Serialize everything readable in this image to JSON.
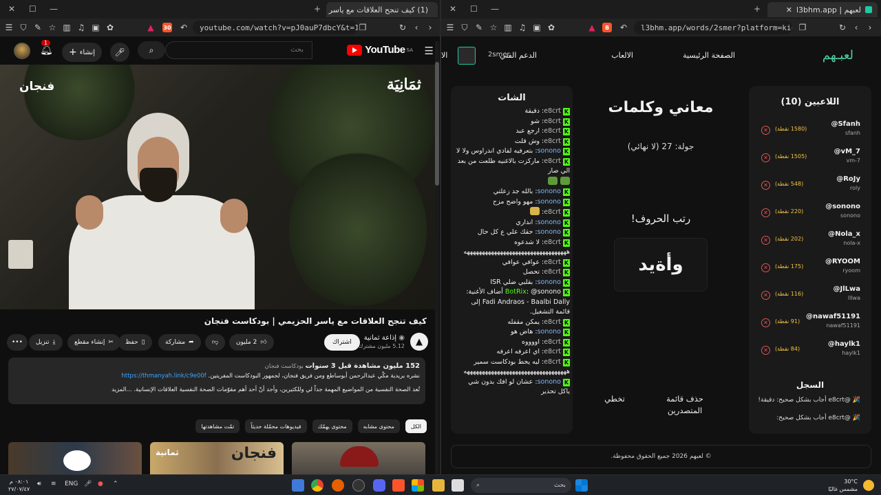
{
  "left_browser": {
    "tab_title": "(1) كيف تنجح العلاقات مع ياسر ا",
    "url": "youtube.com/watch?v=pJ0auP7dbcY&t=1...",
    "shield_count": "30"
  },
  "youtube": {
    "logo_text": "YouTube",
    "region": "SA",
    "search_placeholder": "بحث",
    "create_label": "إنشاء",
    "notif_count": "1",
    "video_overlay_right": "ثمَانِيَة",
    "video_overlay_left": "فنجان",
    "title": "كيف تنجح العلاقات مع ياسر الحزيمي | بودكاست فنجان",
    "channel_name": "إذاعة ثمانية",
    "channel_subs": "5.12 مليون مشترك",
    "subscribe_label": "اشتراك",
    "likes": "2 مليون",
    "share_label": "مشاركة",
    "save_label": "حفظ",
    "clip_label": "إنشاء مقطع",
    "download_label": "تنزيل",
    "desc_views": "152 مليون مشاهدة  قبل 3 سنوات",
    "desc_tag": "بودكاست فنجان",
    "desc_line2": "نشره بريدية مكّي عبدالرحمن أبوساطع ومن فريق فنجان، لجمهور البودكاست المفريتين.",
    "desc_link": "https://thmanyah.link/c9e00f",
    "desc_line3": "تُعد الصحة النفسية من المواضيع المهمة جداً لي وللكثيرين، وأجد أنّ أحد أهم مقوّمات الصحة النفسية العلاقات الإنسانية. ...المزيد",
    "chips": [
      "الكل",
      "محتوى مشابه",
      "محتوى يهمّك",
      "فيديوهات محمّلة حديثاً",
      "تمّت مشاهدتها"
    ],
    "thumb_labels": [
      "فنجان",
      "ثمانية"
    ]
  },
  "right_browser": {
    "tab_title": "لعبهم | l3bhm.app",
    "url": "l3bhm.app/words/2smer?platform=kick"
  },
  "app": {
    "logo": "لعبـهم",
    "nav": {
      "home": "الصفحة الرئيسية",
      "games": "الالعاب",
      "support": "الدعم الفني",
      "user": "2smer",
      "cut": "الا"
    },
    "chat_title": "الشات",
    "chat": [
      {
        "user": "e8crt",
        "text": "دقيقة"
      },
      {
        "user": "e8crt",
        "text": "شو"
      },
      {
        "user": "e8crt",
        "text": "ارجع عبد"
      },
      {
        "user": "e8crt",
        "text": "وش قلت"
      },
      {
        "user": "sonono",
        "text": "بتعرفيه لفادي اندراوس ولا لا"
      },
      {
        "user": "e8crt",
        "text": "ماركزت بالاغنيه طلعت من بعد الي صار"
      },
      {
        "user": "",
        "text": "",
        "emotes": 2
      },
      {
        "user": "sonono",
        "text": "بالله جد زعلتي"
      },
      {
        "user": "sonono",
        "text": "مهو واضح مزح"
      },
      {
        "user": "e8crt",
        "text": "",
        "emotes": 1
      },
      {
        "user": "sonono",
        "text": "انداري"
      },
      {
        "user": "sonono",
        "text": "حقك علي ع كل حال"
      },
      {
        "user": "e8crt",
        "text": "لا شدعوه ههههههههههههههههههههههههههههههههههه"
      },
      {
        "user": "e8crt",
        "text": "عوافي عوافي"
      },
      {
        "user": "e8crt",
        "text": "تحصل"
      },
      {
        "user": "sonono",
        "text": "بقلبي ضلي ISR"
      },
      {
        "user": "BotRix",
        "text": "@sonono أضاف الأغنية: Fadi Andraos - Baalbi Dally إلى قائمة التشغيل."
      },
      {
        "user": "e8crt",
        "text": "يمكن مقفله"
      },
      {
        "user": "sonono",
        "text": "هاض هو"
      },
      {
        "user": "e8crt",
        "text": "اووووه"
      },
      {
        "user": "e8crt",
        "text": "اي اعرفه اعرفه"
      },
      {
        "user": "e8crt",
        "text": "ليه يحط بودكاست سمير ههههههههههههههههههههههههههههههههههه"
      },
      {
        "user": "sonono",
        "text": "عشان لو افك بدون شي ياكل تحذير"
      }
    ],
    "game_title": "معاني وكلمات",
    "round": "جولة: 27 (لا نهائي)",
    "question": "رتب الحروف!",
    "scrambled": "وأةيد",
    "skip_label": "تخطي",
    "clear_label": "حذف قائمة المتصدرين",
    "players_title": "اللاعبين (10)",
    "players": [
      {
        "name": "@Sfanh",
        "user": "sfanh",
        "points": "(1580 نقطة)"
      },
      {
        "name": "@vM_7",
        "user": "vm-7",
        "points": "(1505 نقطة)"
      },
      {
        "name": "@RoJy",
        "user": "roly",
        "points": "(548 نقطة)"
      },
      {
        "name": "@sonono",
        "user": "sonono",
        "points": "(220 نقطة)"
      },
      {
        "name": "@Nola_x",
        "user": "nola-x",
        "points": "(202 نقطة)"
      },
      {
        "name": "@RYOOM",
        "user": "ryoom",
        "points": "(175 نقطة)"
      },
      {
        "name": "@JlLwa",
        "user": "lllwa",
        "points": "(116 نقطة)"
      },
      {
        "name": "@nawaf51191",
        "user": "nawaf51191",
        "points": "(91 نقطة)"
      },
      {
        "name": "@haylk1",
        "user": "haylk1",
        "points": "(84 نقطة)"
      }
    ],
    "log_title": "السجل",
    "log": [
      "🎉 @e8crt أجاب بشكل صحيح: دقيقة!",
      "🎉 @e8crt أجاب بشكل صحيح:"
    ],
    "footer": "© لعبهم 2026 جميع الحقوق محفوظة."
  },
  "taskbar": {
    "search": "بحث",
    "lang": "ENG",
    "time": "٠٨:٠١ م",
    "date": "٢٧/٠٧/٤٧",
    "temp": "30°C",
    "weather": "مشمس غالبًا"
  }
}
